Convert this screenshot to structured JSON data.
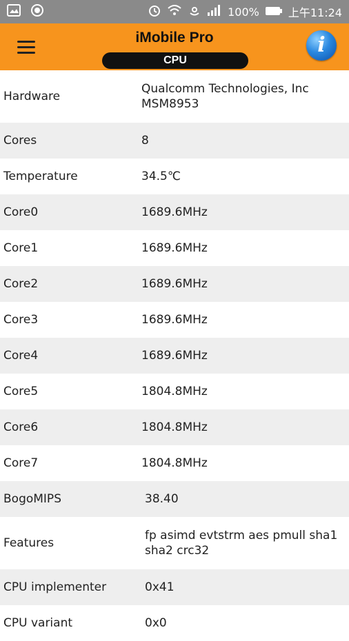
{
  "status": {
    "battery": "100%",
    "time": "上午11:24"
  },
  "header": {
    "title": "iMobile Pro",
    "tab": "CPU",
    "info_label": "i"
  },
  "rows": [
    {
      "label": "Hardware",
      "value": "Qualcomm Technologies, Inc MSM8953"
    },
    {
      "label": "Cores",
      "value": "8"
    },
    {
      "label": "Temperature",
      "value": "34.5℃"
    },
    {
      "label": "Core0",
      "value": "1689.6MHz"
    },
    {
      "label": "Core1",
      "value": "1689.6MHz"
    },
    {
      "label": "Core2",
      "value": "1689.6MHz"
    },
    {
      "label": "Core3",
      "value": "1689.6MHz"
    },
    {
      "label": "Core4",
      "value": "1689.6MHz"
    },
    {
      "label": "Core5",
      "value": "1804.8MHz"
    },
    {
      "label": "Core6",
      "value": "1804.8MHz"
    },
    {
      "label": "Core7",
      "value": "1804.8MHz"
    },
    {
      "label": "BogoMIPS",
      "value": "38.40"
    },
    {
      "label": "Features",
      "value": "fp asimd evtstrm aes pmull sha1 sha2 crc32"
    },
    {
      "label": "CPU implementer",
      "value": "0x41"
    },
    {
      "label": "CPU variant",
      "value": "0x0"
    }
  ]
}
